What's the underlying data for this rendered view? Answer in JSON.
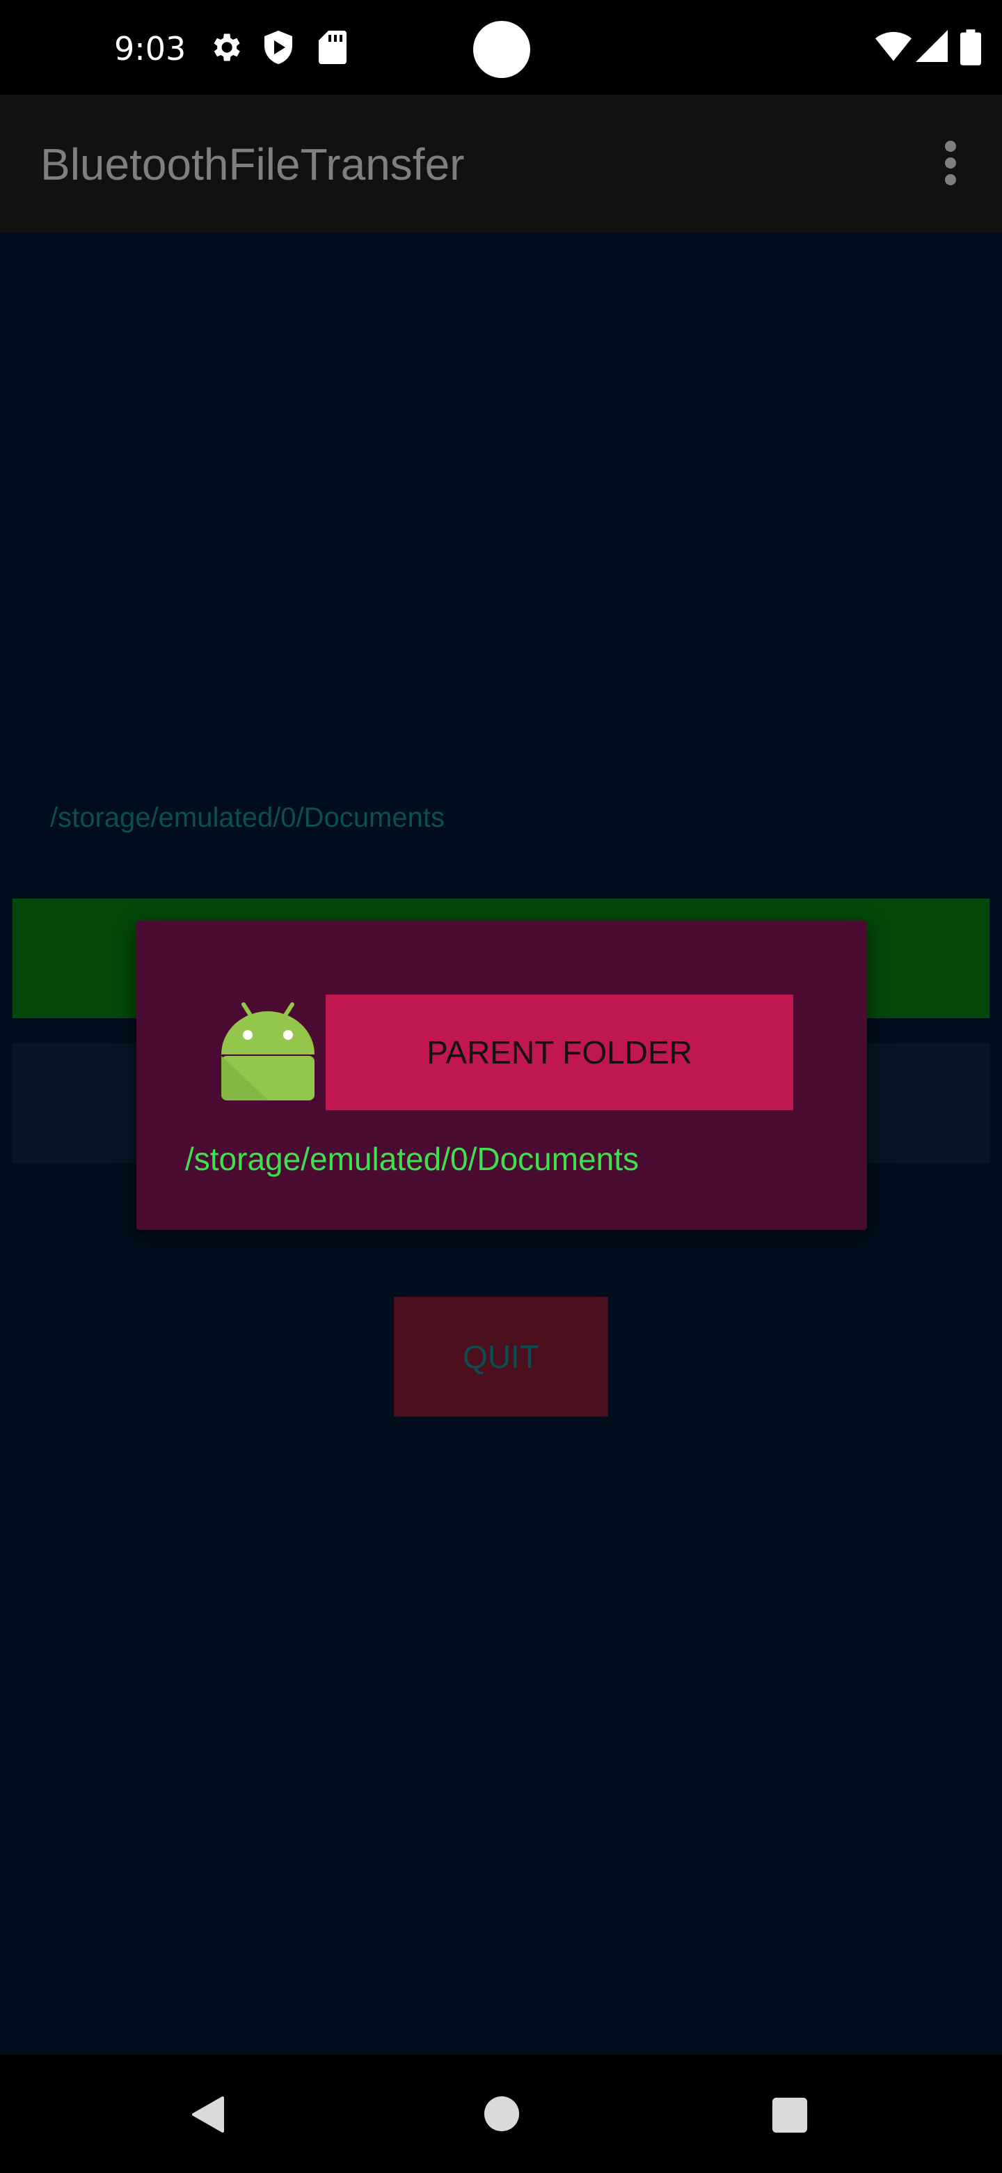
{
  "status_bar": {
    "time": "9:03",
    "icons": [
      "gear-icon",
      "shield-play-icon",
      "sd-card-icon",
      "wifi-icon",
      "signal-icon",
      "battery-icon"
    ]
  },
  "app_bar": {
    "title": "BluetoothFileTransfer",
    "menu_icon": "more-vert-icon"
  },
  "main": {
    "path": "/storage/emulated/0/Documents",
    "quit_label": "QUIT"
  },
  "dialog": {
    "parent_folder_label": "PARENT FOLDER",
    "path": "/storage/emulated/0/Documents",
    "icon": "android-icon"
  },
  "nav_bar": {
    "icons": [
      "back-icon",
      "home-icon",
      "recents-icon"
    ]
  },
  "colors": {
    "content_bg": "#000d1c",
    "dialog_bg": "#4b0a32",
    "accent_button": "#c0174f",
    "path_text": "#3fe04d"
  }
}
